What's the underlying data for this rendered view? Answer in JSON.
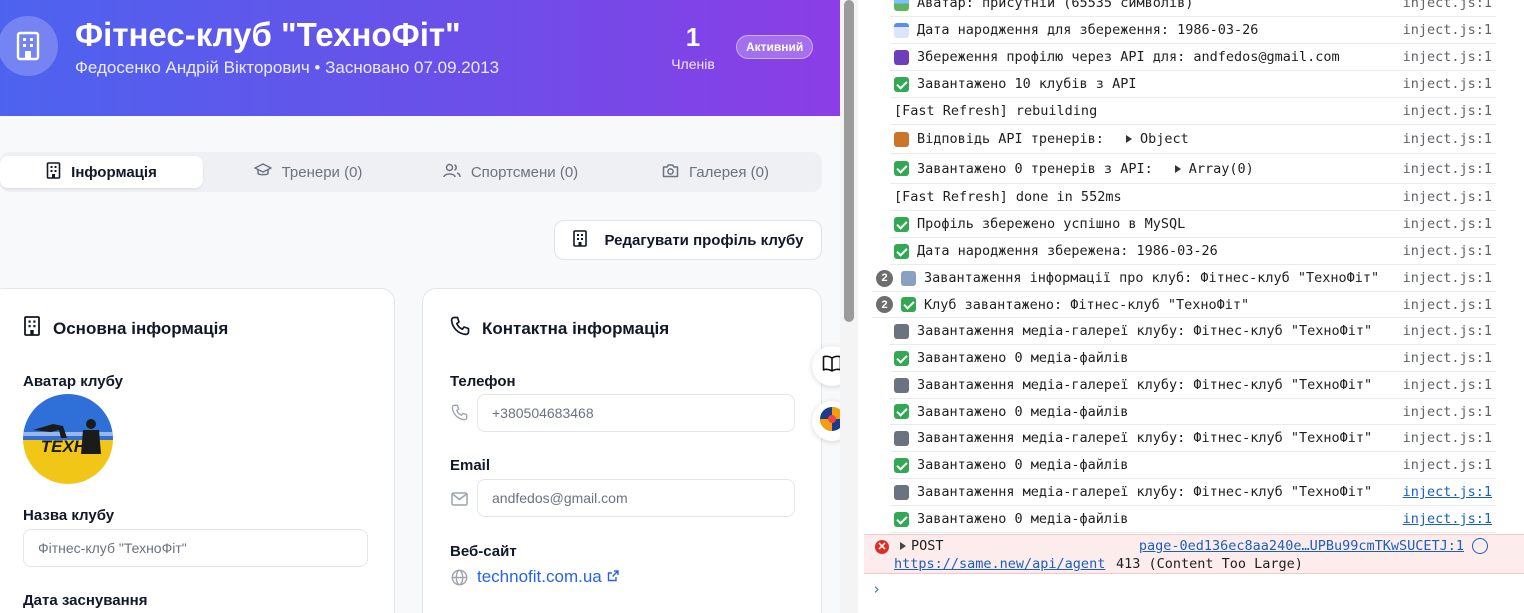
{
  "header": {
    "title": "Фітнес-клуб \"ТехноФіт\"",
    "subtitle": "Федосенко Андрій Вікторович • Засновано 07.09.2013",
    "members_count": "1",
    "members_label": "Членів",
    "status": "Активний",
    "icon": "building-icon"
  },
  "tabs": [
    {
      "label": "Інформація",
      "icon": "building-icon",
      "active": true
    },
    {
      "label": "Тренери (0)",
      "icon": "graduation-cap-icon",
      "active": false
    },
    {
      "label": "Спортсмени (0)",
      "icon": "users-icon",
      "active": false
    },
    {
      "label": "Галерея (0)",
      "icon": "camera-icon",
      "active": false
    }
  ],
  "edit_button": {
    "label": "Редагувати профіль клубу",
    "icon": "building-icon"
  },
  "basic_info": {
    "title": "Основна інформація",
    "avatar_label": "Аватар клубу",
    "avatar_text": "ТЕХНО",
    "name_label": "Назва клубу",
    "name_placeholder": "Фітнес-клуб \"ТехноФіт\"",
    "founded_label": "Дата заснування"
  },
  "contact_info": {
    "title": "Контактна інформація",
    "phone_label": "Телефон",
    "phone_value": "+380504683468",
    "email_label": "Email",
    "email_value": "andfedos@gmail.com",
    "website_label": "Веб-сайт",
    "website_value": "technofit.com.ua"
  },
  "colors": {
    "gradient_start": "#4d63ef",
    "gradient_end": "#8b3de6",
    "link": "#2563eb"
  },
  "console": {
    "logs": [
      {
        "icon": "image-icon",
        "text": "Аватар: присутній (65535 символів)",
        "source": "inject.js:1"
      },
      {
        "icon": "calendar-icon",
        "text": "Дата народження для збереження: 1986-03-26",
        "source": "inject.js:1"
      },
      {
        "icon": "floppy-disk-icon",
        "text": "Збереження профілю через API для: andfedos@gmail.com",
        "source": "inject.js:1"
      },
      {
        "icon": "check-icon",
        "text": "Завантажено 10 клубів з API",
        "source": "inject.js:1"
      },
      {
        "icon": "",
        "text": "[Fast Refresh] rebuilding",
        "source": "inject.js:1"
      },
      {
        "icon": "sport-icon",
        "text": "Відповідь API тренерів:",
        "expand": "Object",
        "source": "inject.js:1"
      },
      {
        "icon": "check-icon",
        "text": "Завантажено 0 тренерів з API:",
        "expand": "Array(0)",
        "source": "inject.js:1"
      },
      {
        "icon": "",
        "text": "[Fast Refresh] done in 552ms",
        "source": "inject.js:1"
      },
      {
        "icon": "check-icon",
        "text": "Профіль збережено успішно в MySQL",
        "source": "inject.js:1"
      },
      {
        "icon": "check-icon",
        "text": "Дата народження збережена: 1986-03-26",
        "source": "inject.js:1"
      },
      {
        "icon": "building-icon",
        "text": "Завантаження інформації про клуб: Фітнес-клуб \"ТехноФіт\"",
        "repeat": "2",
        "source": "inject.js:1"
      },
      {
        "icon": "check-icon",
        "text": "Клуб завантажено: Фітнес-клуб \"ТехноФіт\"",
        "repeat": "2",
        "source": "inject.js:1"
      },
      {
        "icon": "camera-icon",
        "text": "Завантаження медіа-галереї клубу: Фітнес-клуб \"ТехноФіт\"",
        "source": "inject.js:1"
      },
      {
        "icon": "check-icon",
        "text": "Завантажено 0 медіа-файлів",
        "source": "inject.js:1"
      },
      {
        "icon": "camera-icon",
        "text": "Завантаження медіа-галереї клубу: Фітнес-клуб \"ТехноФіт\"",
        "source": "inject.js:1"
      },
      {
        "icon": "check-icon",
        "text": "Завантажено 0 медіа-файлів",
        "source": "inject.js:1"
      },
      {
        "icon": "camera-icon",
        "text": "Завантаження медіа-галереї клубу: Фітнес-клуб \"ТехноФіт\"",
        "source": "inject.js:1"
      },
      {
        "icon": "check-icon",
        "text": "Завантажено 0 медіа-файлів",
        "source": "inject.js:1"
      },
      {
        "icon": "camera-icon",
        "text": "Завантаження медіа-галереї клубу: Фітнес-клуб \"ТехноФіт\"",
        "source": "inject.js:1",
        "link": true
      },
      {
        "icon": "check-icon",
        "text": "Завантажено 0 медіа-файлів",
        "source": "inject.js:1",
        "link": true
      }
    ],
    "error": {
      "method": "POST",
      "source": "page-0ed136ec8aa240e…UPBu99cmTKwSUCETJ:1",
      "url": "https://same.new/api/agent",
      "status": "413 (Content Too Large)"
    },
    "prompt": "›"
  }
}
